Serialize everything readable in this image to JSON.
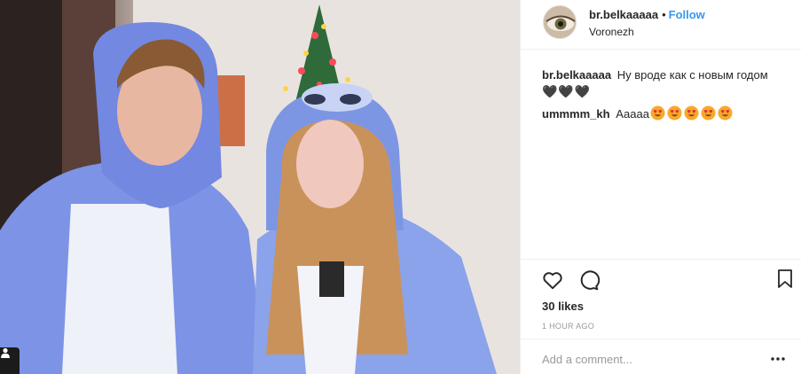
{
  "post": {
    "username": "br.belkaaaaa",
    "separator": "•",
    "follow_label": "Follow",
    "location": "Voronezh",
    "user_tag_icon": "person-icon"
  },
  "comments": [
    {
      "user": "br.belkaaaaa",
      "text": "Ну вроде как с новым годом",
      "extra": "🖤🖤🖤"
    },
    {
      "user": "ummmm_kh",
      "text": "Аааaa",
      "emoji_count": 5,
      "emoji": "heart-eyes-emoji"
    }
  ],
  "actions": {
    "like_icon": "heart-icon",
    "comment_icon": "comment-icon",
    "save_icon": "bookmark-icon",
    "likes_text": "30 likes",
    "time_text": "1 HOUR AGO"
  },
  "add_comment": {
    "placeholder": "Add a comment...",
    "more_icon": "more-options-icon"
  },
  "colors": {
    "accent": "#3897f0",
    "text": "#262626",
    "muted": "#999999",
    "border": "#efefef"
  }
}
